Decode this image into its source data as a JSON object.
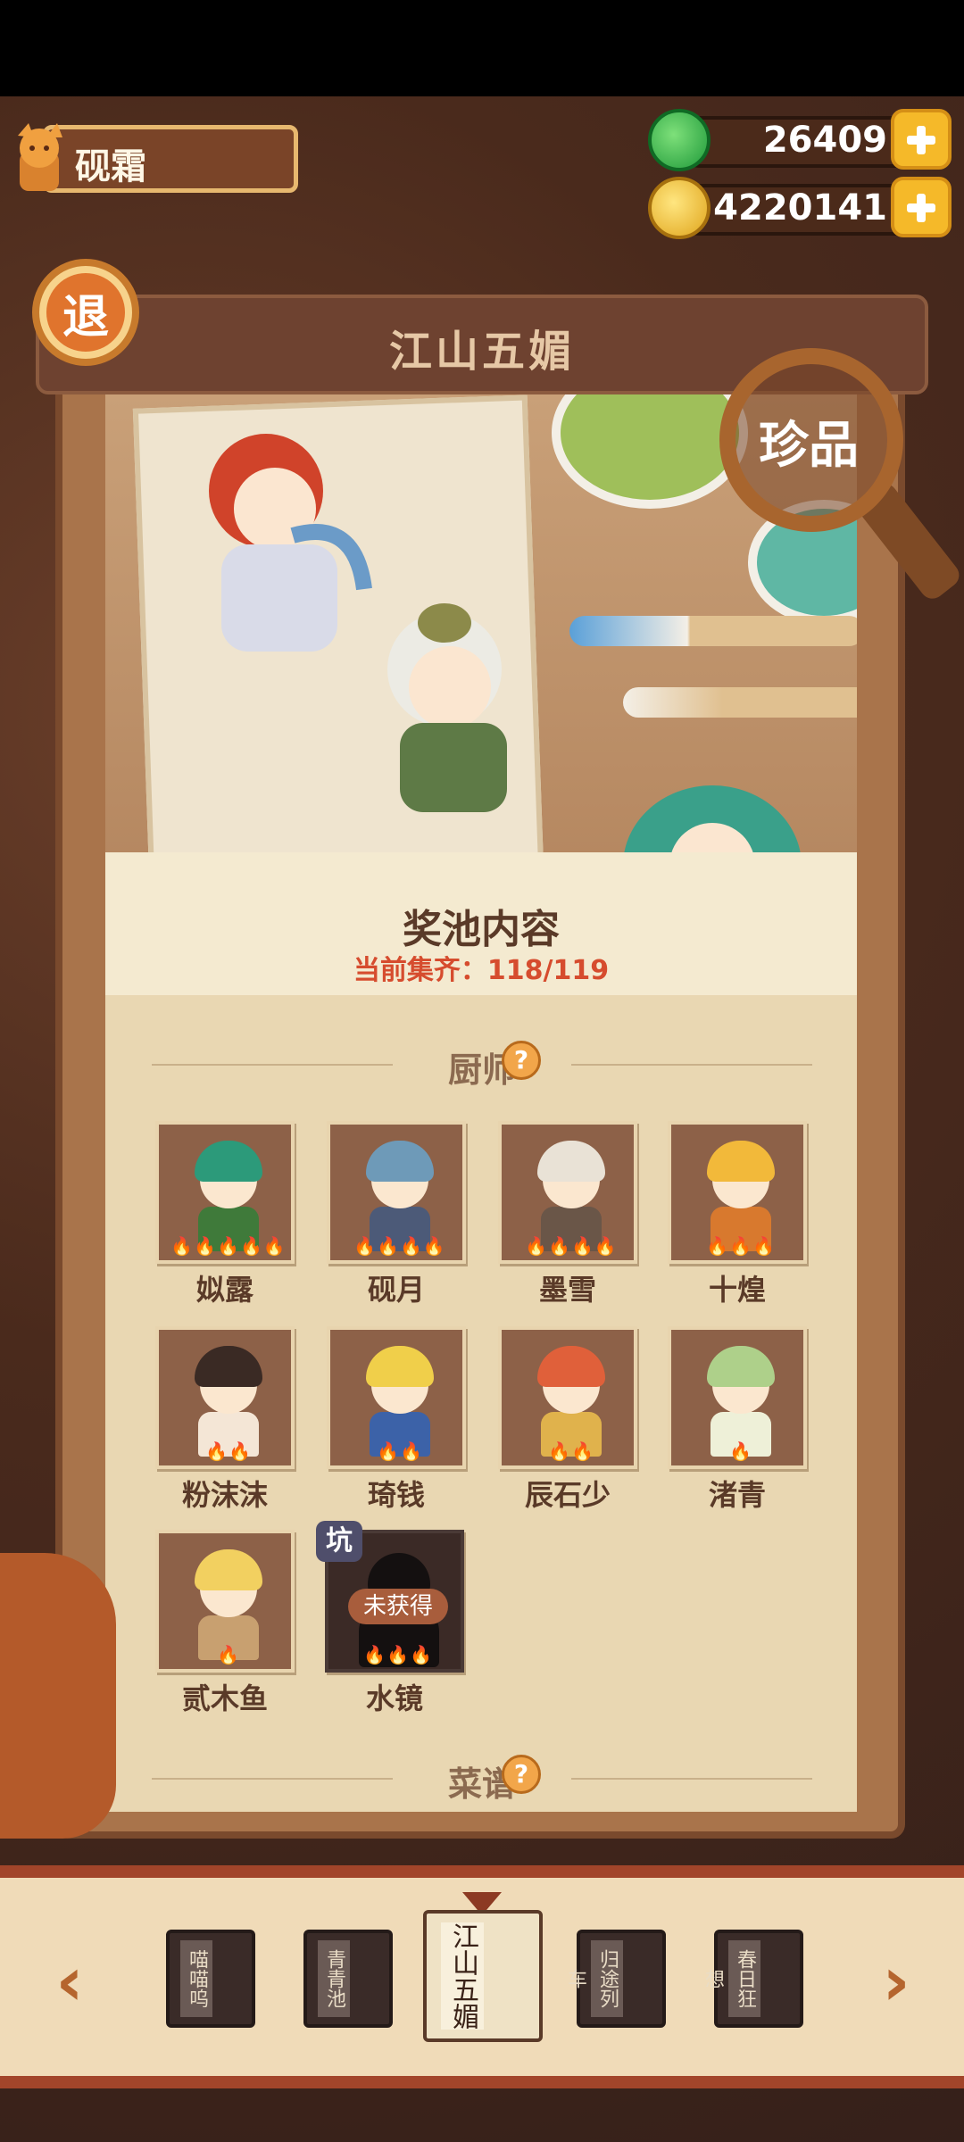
{
  "player": {
    "name": "砚霜"
  },
  "currencies": [
    {
      "icon": "jade-coin-icon",
      "value": "26409",
      "color": "#2fb24a"
    },
    {
      "icon": "gold-coin-icon",
      "value": "4220141",
      "color": "#f5c431"
    }
  ],
  "exit_button": {
    "label": "退"
  },
  "panel": {
    "title": "江山五媚"
  },
  "rare_button": {
    "label": "珍品"
  },
  "pool": {
    "title": "奖池内容",
    "progress": "当前集齐：118/119"
  },
  "sections": {
    "chefs": "厨师",
    "recipes": "菜谱",
    "help_glyph": "?"
  },
  "chefs": [
    {
      "name": "姒露",
      "flames": "🔥🔥🔥🔥🔥",
      "hair": "#2c9a7a",
      "body": "#3f7a3a"
    },
    {
      "name": "砚月",
      "flames": "🔥🔥🔥🔥",
      "hair": "#6e9ab8",
      "body": "#4c5a78"
    },
    {
      "name": "墨雪",
      "flames": "🔥🔥🔥🔥",
      "hair": "#e9e2d6",
      "body": "#6a5648"
    },
    {
      "name": "十煌",
      "flames": "🔥🔥🔥",
      "hair": "#f2b93a",
      "body": "#d8792e"
    },
    {
      "name": "粉沫沫",
      "flames": "🔥🔥",
      "hair": "#3a2a24",
      "body": "#f4e6d6"
    },
    {
      "name": "琦钱",
      "flames": "🔥🔥",
      "hair": "#f0cf4a",
      "body": "#3c62a8"
    },
    {
      "name": "辰石少",
      "flames": "🔥🔥",
      "hair": "#e0603a",
      "body": "#e0b24c"
    },
    {
      "name": "渚青",
      "flames": "🔥",
      "hair": "#aed08a",
      "body": "#eef0d8"
    },
    {
      "name": "贰木鱼",
      "flames": "🔥",
      "hair": "#f2d060",
      "body": "#c8a070"
    }
  ],
  "locked_chef": {
    "name": "水镜",
    "status": "未获得",
    "badge": "坑",
    "flames": "🔥🔥🔥"
  },
  "books": [
    "喵喵呜",
    "青青池",
    "江山五媚",
    "归途列车",
    "春日狂想"
  ],
  "nav": {
    "prev": "‹",
    "next": "›"
  }
}
